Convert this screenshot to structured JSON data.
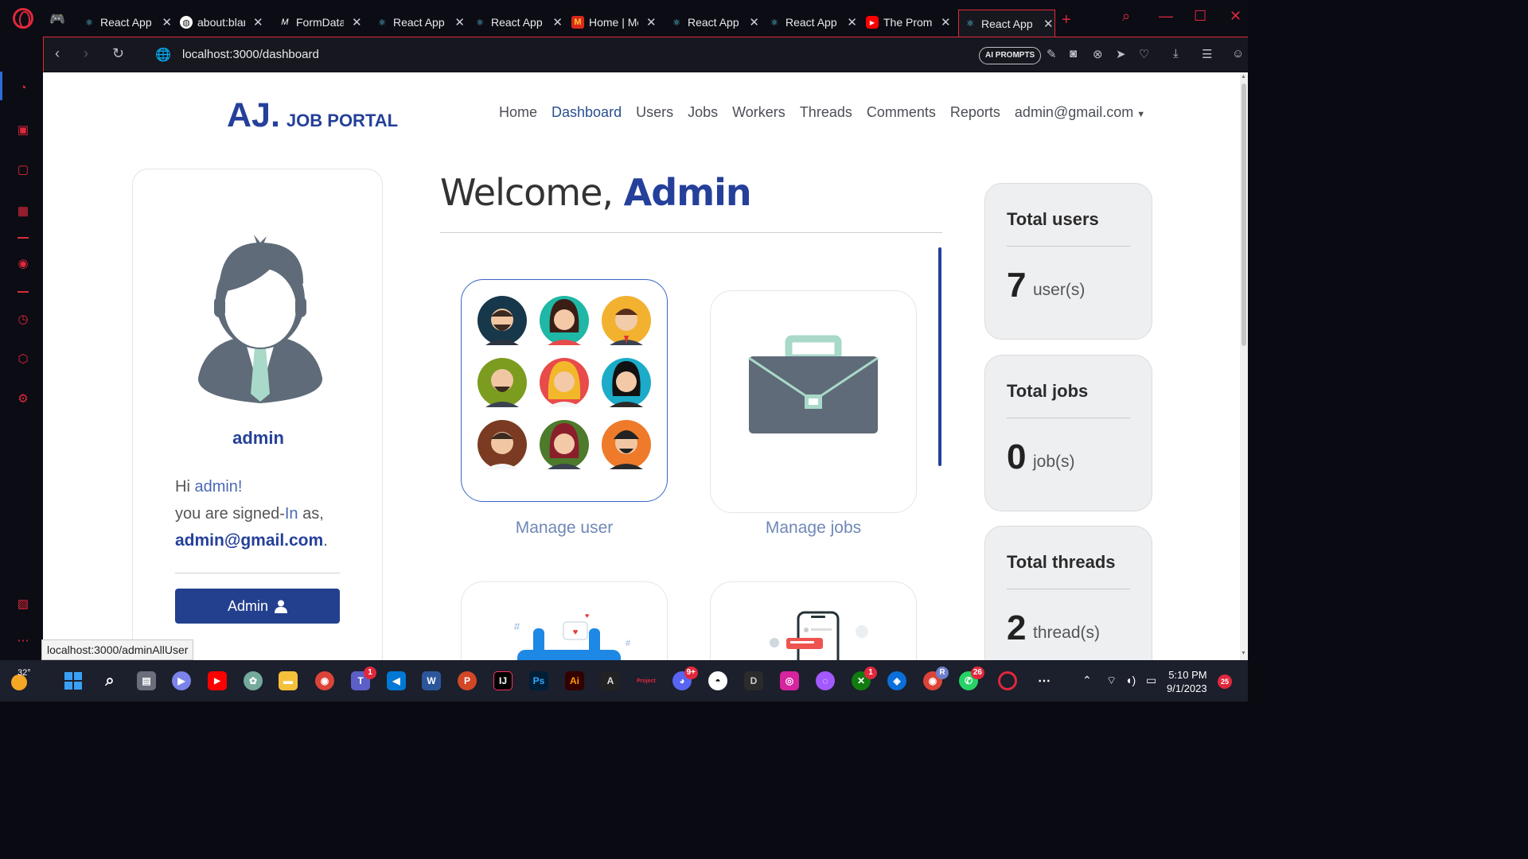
{
  "browser": {
    "tabs": [
      {
        "title": "React App",
        "icon": "react-icon"
      },
      {
        "title": "about:blank",
        "icon": "globe-icon"
      },
      {
        "title": "FormData",
        "icon": "mdn-icon"
      },
      {
        "title": "React App",
        "icon": "react-icon"
      },
      {
        "title": "React App",
        "icon": "react-icon"
      },
      {
        "title": "Home | Mc",
        "icon": "mcdonalds-icon"
      },
      {
        "title": "React App",
        "icon": "react-icon"
      },
      {
        "title": "React App",
        "icon": "react-icon"
      },
      {
        "title": "The Promi",
        "icon": "youtube-icon"
      },
      {
        "title": "React App",
        "icon": "react-icon",
        "active": true
      }
    ],
    "url": "localhost:3000/dashboard",
    "ai_prompts": "AI PROMPTS",
    "status_url": "localhost:3000/adminAllUser",
    "accent": "#e0283c"
  },
  "site": {
    "brand_main": "AJ.",
    "brand_sub": "JOB PORTAL",
    "nav": [
      "Home",
      "Dashboard",
      "Users",
      "Jobs",
      "Workers",
      "Threads",
      "Comments",
      "Reports"
    ],
    "nav_active": "Dashboard",
    "account": "admin@gmail.com",
    "brand_color": "#25409a"
  },
  "profile": {
    "username": "admin",
    "greet_prefix": "Hi ",
    "greet_name": "admin!",
    "signed_line_a": "you are signed-",
    "signed_line_b": "In",
    "signed_line_c": " as,",
    "email": "admin@gmail.com",
    "email_suffix": ".",
    "button_label": "Admin"
  },
  "main": {
    "welcome_prefix": "Welcome, ",
    "welcome_name": "Admin",
    "cards": [
      {
        "label": "Manage user",
        "icon": "users-grid-icon"
      },
      {
        "label": "Manage jobs",
        "icon": "briefcase-icon"
      },
      {
        "label": "",
        "icon": "threads-illustration"
      },
      {
        "label": "",
        "icon": "phone-comments-illustration"
      }
    ]
  },
  "stats": [
    {
      "title": "Total users",
      "value": "7",
      "unit": "user(s)"
    },
    {
      "title": "Total jobs",
      "value": "0",
      "unit": "job(s)"
    },
    {
      "title": "Total threads",
      "value": "2",
      "unit": "thread(s)"
    }
  ],
  "taskbar": {
    "temperature": "32°",
    "time": "5:10 PM",
    "date": "9/1/2023",
    "notification_count": "25",
    "badges": {
      "teams": "1",
      "discord": "9+",
      "xbox": "1",
      "whatsapp": "26",
      "chrome_profile": "R"
    },
    "app_labels": {
      "photoshop": "Ps",
      "illustrator": "Ai",
      "dev": "D",
      "project": "Project"
    }
  }
}
